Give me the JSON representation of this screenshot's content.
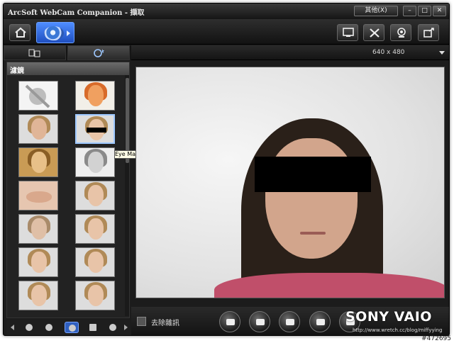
{
  "window": {
    "title": "ArcSoft WebCam Companion - 擷取",
    "menu_label": "其他(X)",
    "minimize": "–",
    "maximize": "□",
    "close": "✕"
  },
  "toolbar": {
    "home_icon": "home-icon",
    "mode_icon": "webcam-icon",
    "right_icons": [
      "screen-icon",
      "tools-icon",
      "webcam-settings-icon",
      "share-icon"
    ]
  },
  "tabs": [
    {
      "icon": "slideshow-icon",
      "active": false
    },
    {
      "icon": "camera-effects-icon",
      "active": true
    }
  ],
  "resolution": "640 x 480",
  "effects_panel": {
    "heading": "濾鏡",
    "tooltip": "Eye Mask",
    "selected_index": 3
  },
  "preview": {
    "denoise_label": "去除雜訊"
  },
  "bottom_buttons": [
    "capture-icon",
    "frames-icon",
    "people-icon",
    "video-icon"
  ],
  "branding": {
    "logo": "SONY VAIO",
    "url": "http://www.wretch.cc/blog/miffyying"
  },
  "watermark": "#472695",
  "colors": {
    "accent": "#2f6fe0",
    "background": "#1c1c1c"
  }
}
